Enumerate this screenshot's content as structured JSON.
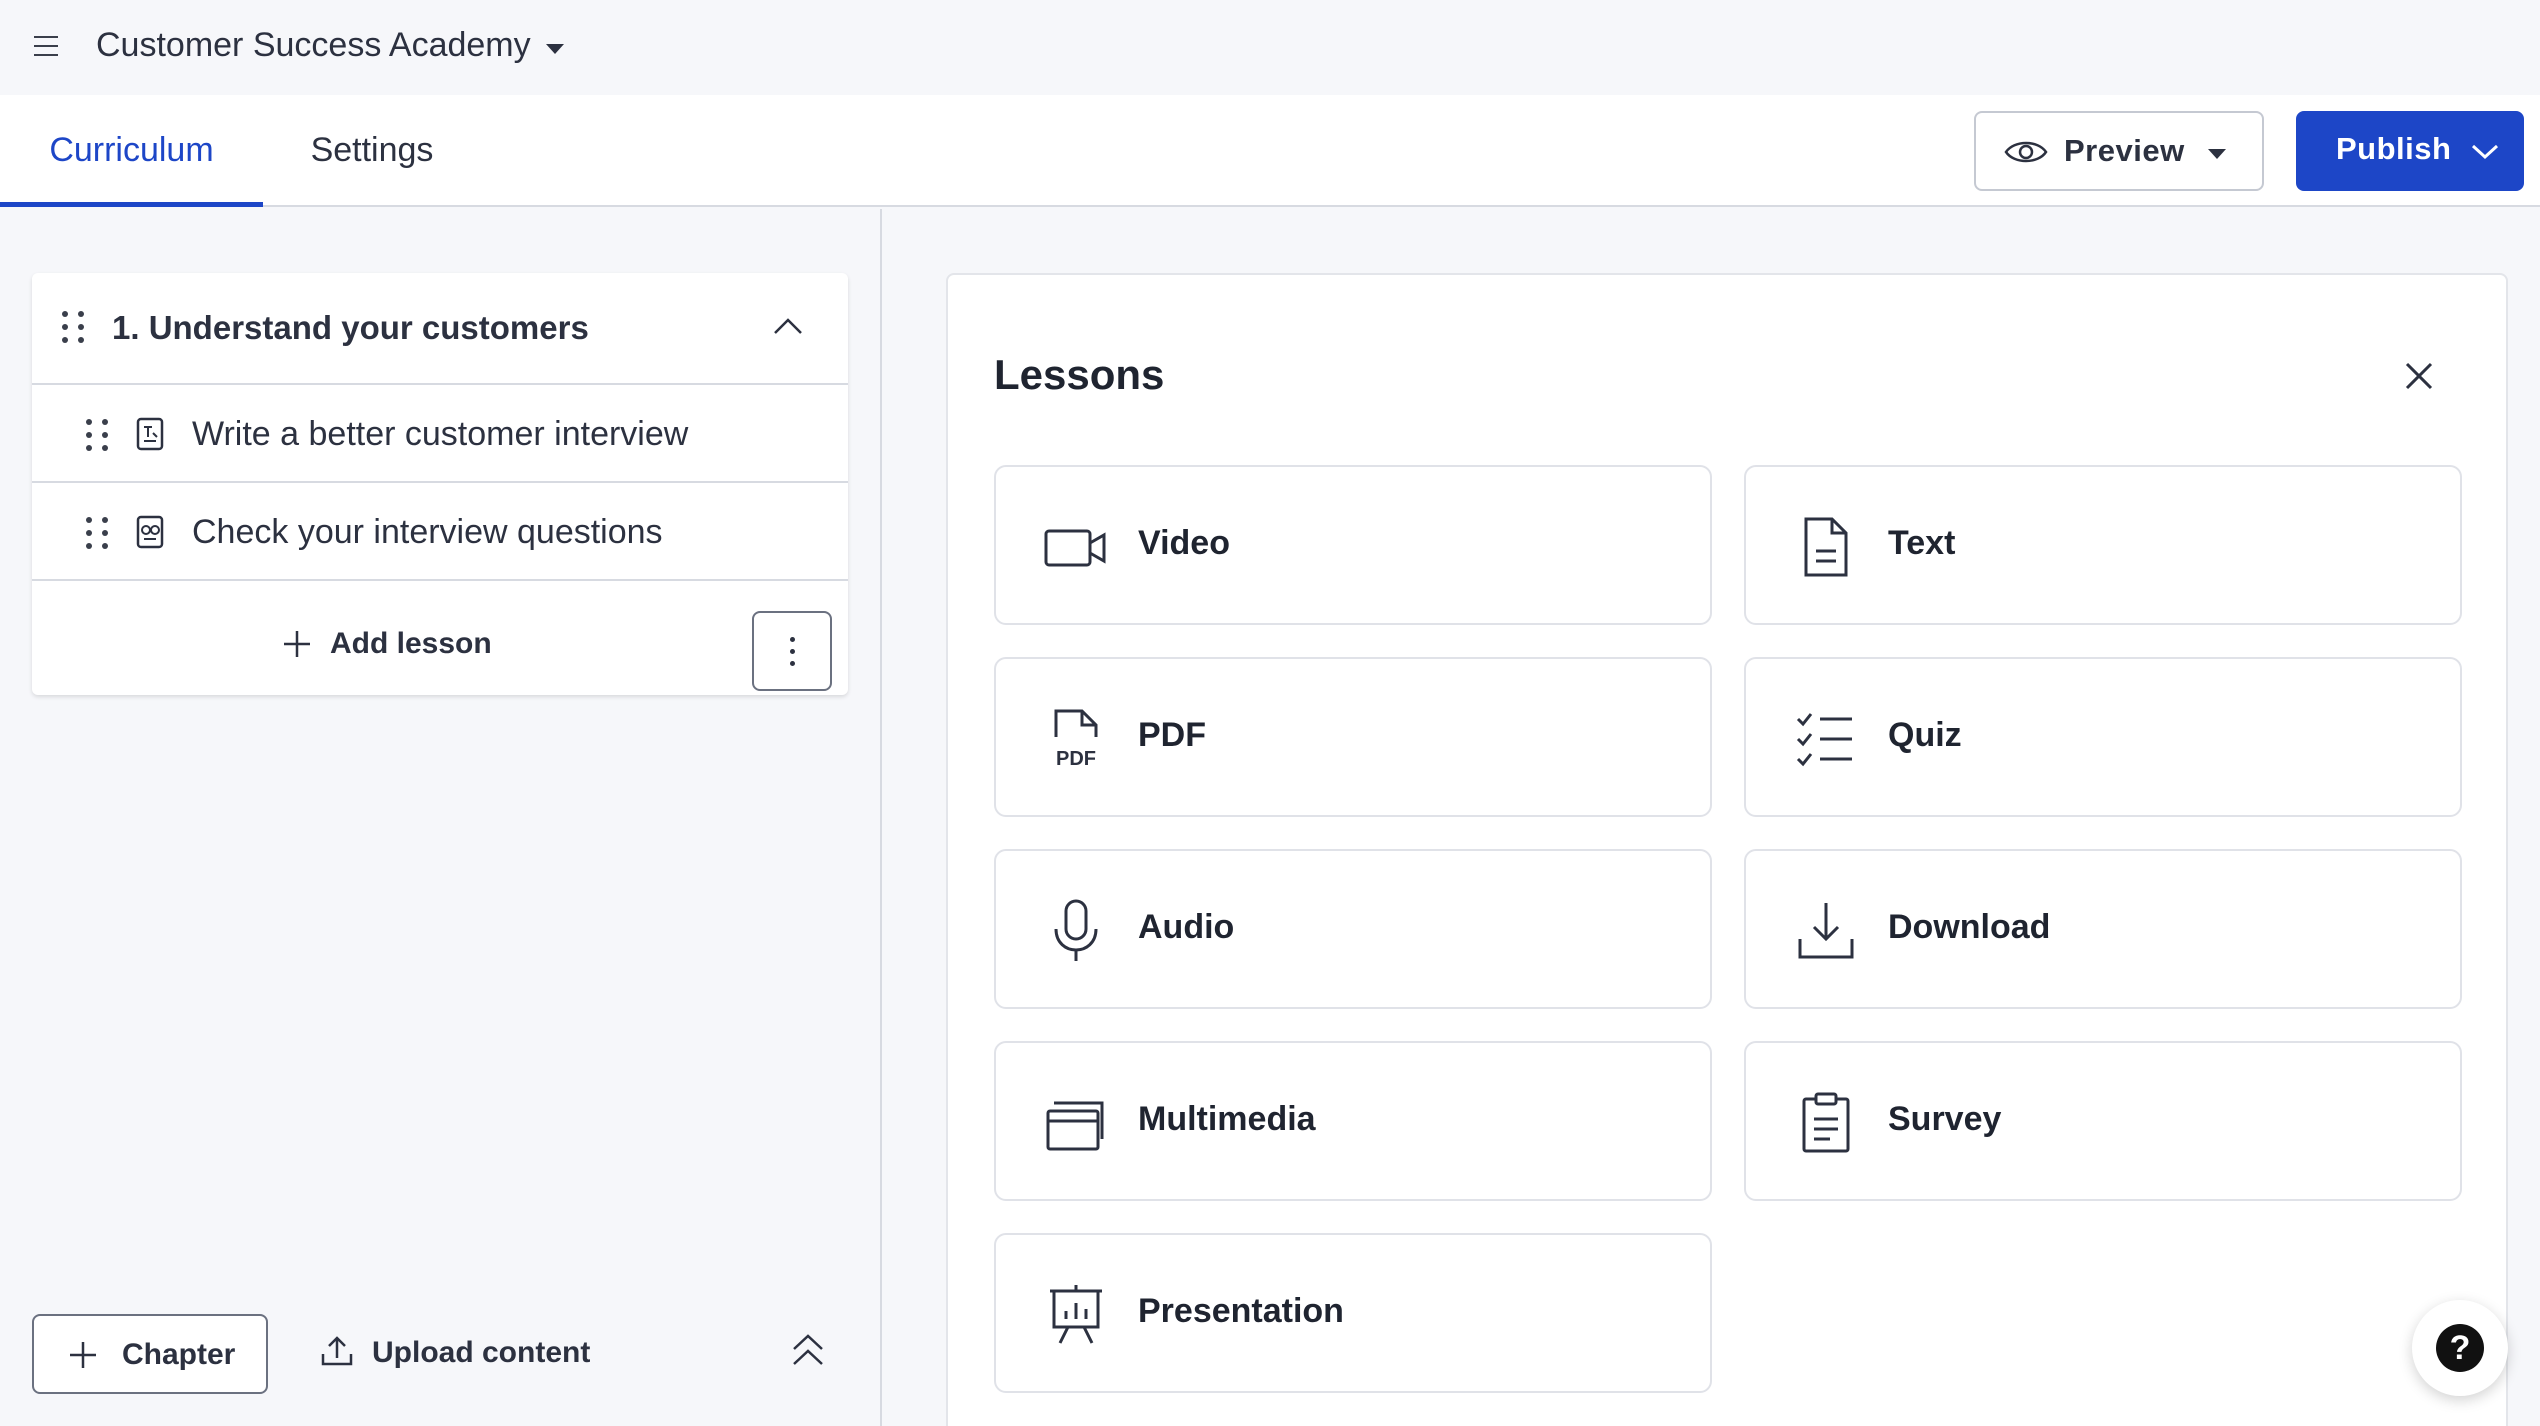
{
  "header": {
    "app_title": "Customer Success Academy",
    "menu_icon": "hamburger-icon",
    "title_dropdown_icon": "caret-down-icon"
  },
  "tabs": [
    {
      "label": "Curriculum",
      "active": true
    },
    {
      "label": "Settings",
      "active": false
    }
  ],
  "toolbar": {
    "preview_label": "Preview",
    "publish_label": "Publish",
    "accent_color": "#1d46c7"
  },
  "chapter": {
    "title": "1. Understand your customers",
    "lessons": [
      {
        "title": "Write a better customer interview",
        "icon": "text-lesson-icon"
      },
      {
        "title": "Check your interview questions",
        "icon": "quiz-lesson-icon"
      }
    ],
    "add_lesson_label": "Add lesson"
  },
  "footer": {
    "chapter_label": "Chapter",
    "upload_label": "Upload content"
  },
  "lessons_panel": {
    "title": "Lessons",
    "types": [
      {
        "label": "Video",
        "icon": "video-icon"
      },
      {
        "label": "Text",
        "icon": "document-icon"
      },
      {
        "label": "PDF",
        "icon": "pdf-icon"
      },
      {
        "label": "Quiz",
        "icon": "checklist-icon"
      },
      {
        "label": "Audio",
        "icon": "microphone-icon"
      },
      {
        "label": "Download",
        "icon": "download-icon"
      },
      {
        "label": "Multimedia",
        "icon": "multimedia-icon"
      },
      {
        "label": "Survey",
        "icon": "clipboard-icon"
      },
      {
        "label": "Presentation",
        "icon": "presentation-icon"
      }
    ]
  },
  "help": {
    "label": "?"
  }
}
